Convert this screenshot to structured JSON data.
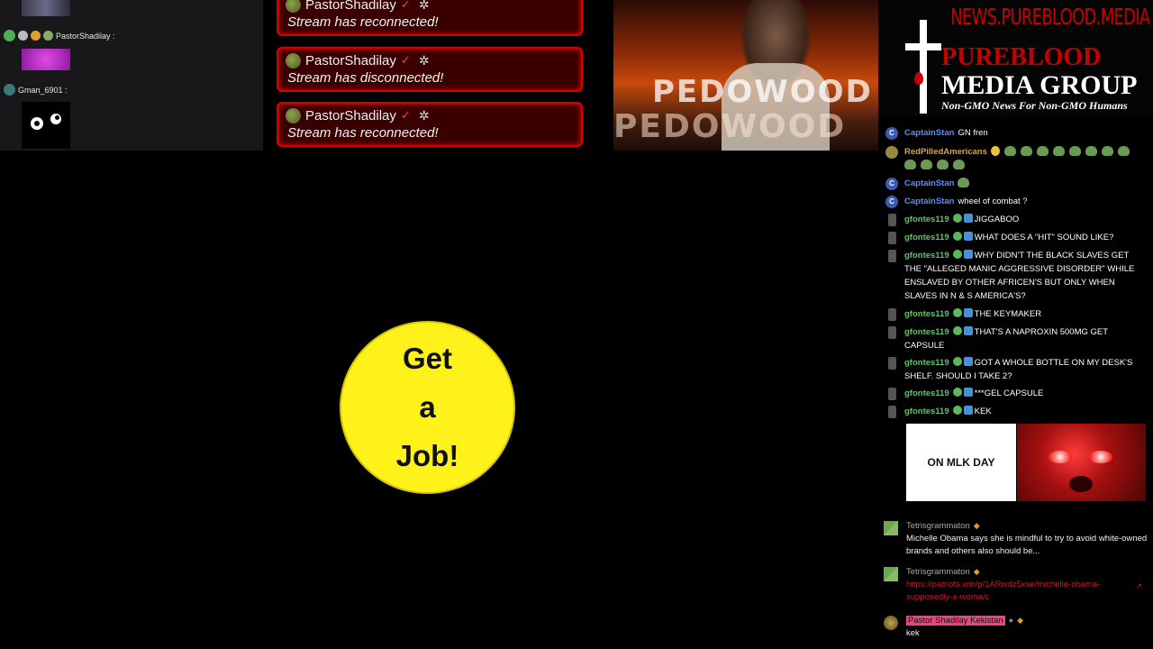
{
  "left_chat": {
    "row1_user": "PastorShadilay :",
    "row2_user": "Gman_6901 :"
  },
  "alerts": [
    {
      "name": "PastorShadilay",
      "message": "Stream has reconnected!"
    },
    {
      "name": "PastorShadilay",
      "message": "Stream has disconnected!"
    },
    {
      "name": "PastorShadilay",
      "message": "Stream has reconnected!"
    }
  ],
  "video_thumb": {
    "text_1": "PEDOWOOD",
    "text_2": "PEDOWOOD"
  },
  "logo": {
    "url": "NEWS.PUREBLOOD.MEDIA",
    "line1": "PUREBLOOD",
    "line2": "MEDIA GROUP",
    "tagline": "Non-GMO News For Non-GMO Humans"
  },
  "right_chat": {
    "messages": [
      {
        "user": "CaptainStan",
        "text": "GN fren"
      },
      {
        "user": "RedPilledAmericans",
        "text": ""
      },
      {
        "user": "CaptainStan",
        "text": ""
      },
      {
        "user": "CaptainStan",
        "text": "wheel of combat ?"
      },
      {
        "user": "gfontes119",
        "text": "JIGGABOO"
      },
      {
        "user": "gfontes119",
        "text": "WHAT DOES A \"HIT\" SOUND LIKE?"
      },
      {
        "user": "gfontes119",
        "text": "WHY DIDN'T THE BLACK SLAVES GET THE \"ALLEGED MANIC AGGRESSIVE DISORDER\" WHILE ENSLAVED BY OTHER AFRICEN'S BUT ONLY WHEN SLAVES IN N & S AMERICA'S?"
      },
      {
        "user": "gfontes119",
        "text": "THE KEYMAKER"
      },
      {
        "user": "gfontes119",
        "text": "THAT'S A NAPROXIN 500MG GET CAPSULE"
      },
      {
        "user": "gfontes119",
        "text": "GOT A WHOLE BOTTLE ON MY DESK'S SHELF. SHOULD I TAKE 2?"
      },
      {
        "user": "gfontes119",
        "text": "***GEL CAPSULE"
      },
      {
        "user": "gfontes119",
        "text": "KEK"
      }
    ],
    "colors": {
      "captain": "#5b8cff",
      "redpilled": "#d4a84b",
      "gfontes": "#61c36c"
    }
  },
  "sign": {
    "line1": "Get",
    "line2": "a",
    "line3": "Job!"
  },
  "meme": {
    "caption": "ON MLK DAY"
  },
  "comments": [
    {
      "name": "Tetrisgrammaton",
      "text": "Michelle Obama says she is mindful to try to avoid white-owned brands and others also should be..."
    },
    {
      "name": "Tetrisgrammaton",
      "link": "https://patriots.win/p/1ARwdz5xse/michelle-obama-supposedly-a-woma/c"
    },
    {
      "name": "Pastor Shadilay Kekistan",
      "text": "kek"
    }
  ]
}
